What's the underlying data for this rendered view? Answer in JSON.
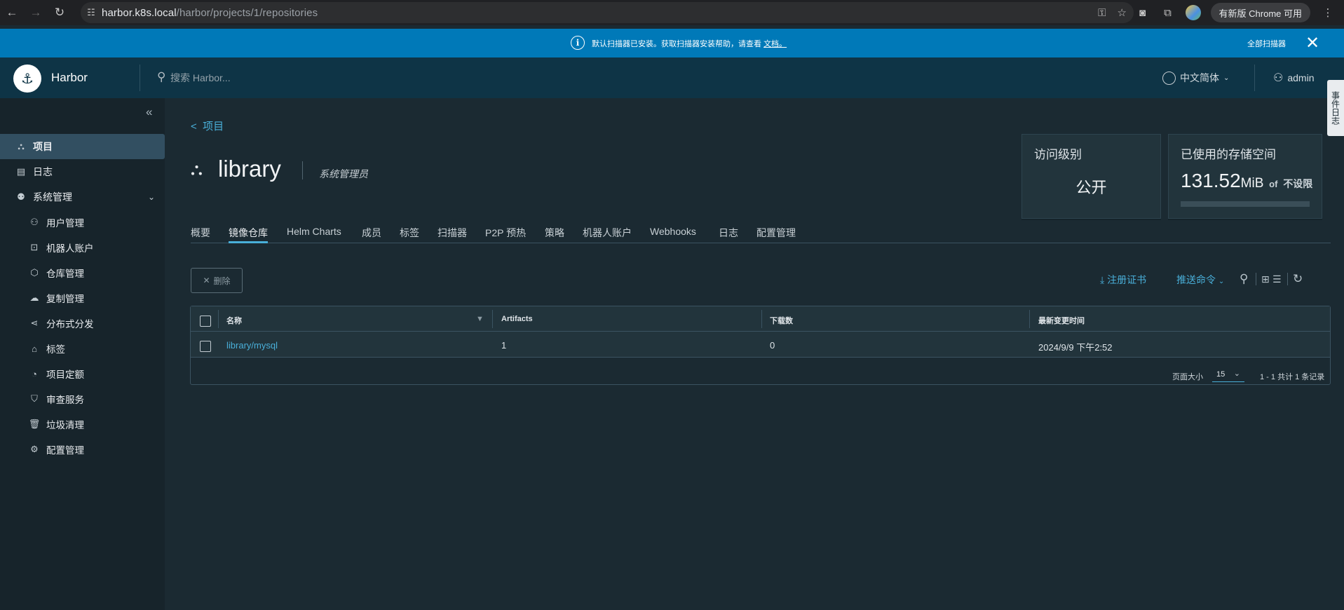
{
  "browser": {
    "url_host": "harbor.k8s.local",
    "url_path": "/harbor/projects/1/repositories",
    "update_label": "有新版 Chrome 可用"
  },
  "banner": {
    "message": "默认扫描器已安装。获取扫描器安装帮助，请查看",
    "link": "文档。",
    "action": "全部扫描器"
  },
  "header": {
    "brand": "Harbor",
    "search_placeholder": "搜索 Harbor...",
    "language": "中文简体",
    "user": "admin",
    "side_tab": "事件日志"
  },
  "sidebar": {
    "items": [
      {
        "label": "项目",
        "icon": "project-icon"
      },
      {
        "label": "日志",
        "icon": "log-icon"
      },
      {
        "label": "系统管理",
        "icon": "admin-icon"
      }
    ],
    "sub_items": [
      {
        "label": "用户管理",
        "icon": "users-icon"
      },
      {
        "label": "机器人账户",
        "icon": "robot-icon"
      },
      {
        "label": "仓库管理",
        "icon": "box-icon"
      },
      {
        "label": "复制管理",
        "icon": "cloud-icon"
      },
      {
        "label": "分布式分发",
        "icon": "share-icon"
      },
      {
        "label": "标签",
        "icon": "tag-icon"
      },
      {
        "label": "项目定额",
        "icon": "quota-icon"
      },
      {
        "label": "审查服务",
        "icon": "shield-icon"
      },
      {
        "label": "垃圾清理",
        "icon": "trash-icon"
      },
      {
        "label": "配置管理",
        "icon": "gear-icon"
      }
    ]
  },
  "project": {
    "breadcrumb": "项目",
    "name": "library",
    "role": "系统管理员"
  },
  "cards": {
    "access_title": "访问级别",
    "access_value": "公开",
    "storage_title": "已使用的存储空间",
    "storage_value": "131.52",
    "storage_unit": "MiB",
    "storage_of": "of",
    "storage_limit": "不设限",
    "storage_usage_fraction": 0
  },
  "tabs": [
    "概要",
    "镜像仓库",
    "Helm Charts",
    "成员",
    "标签",
    "扫描器",
    "P2P 预热",
    "策略",
    "机器人账户",
    "Webhooks",
    "日志",
    "配置管理"
  ],
  "toolbar": {
    "delete": "删除",
    "register_cert": "注册证书",
    "push_command": "推送命令"
  },
  "table": {
    "columns": [
      "名称",
      "Artifacts",
      "下载数",
      "最新变更时间"
    ],
    "rows": [
      {
        "name": "library/mysql",
        "artifacts": "1",
        "pulls": "0",
        "updated": "2024/9/9 下午2:52"
      }
    ],
    "page_size_label": "页面大小",
    "page_size": "15",
    "summary": "1 - 1 共计 1 条记录"
  },
  "colors": {
    "banner": "#0079b8",
    "header": "#0e3446",
    "accent": "#49afd9",
    "background": "#1b2a32"
  }
}
